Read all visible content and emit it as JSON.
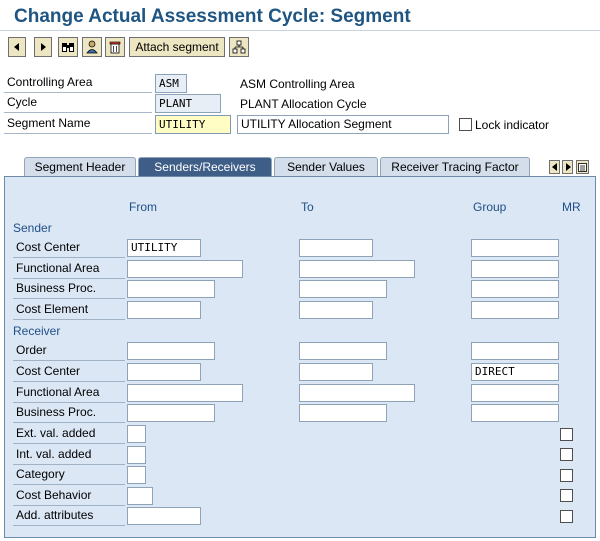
{
  "title": "Change Actual Assessment Cycle: Segment",
  "toolbar": {
    "attach_segment_label": "Attach segment"
  },
  "header": {
    "controlling_area": {
      "label": "Controlling Area",
      "value": "ASM",
      "desc": "ASM Controlling Area"
    },
    "cycle": {
      "label": "Cycle",
      "value": "PLANT",
      "desc": "PLANT Allocation Cycle"
    },
    "segment_name": {
      "label": "Segment Name",
      "value": "UTILITY",
      "desc": "UTILITY Allocation Segment"
    },
    "lock_indicator_label": "Lock indicator"
  },
  "tabs": [
    {
      "label": "Segment Header"
    },
    {
      "label": "Senders/Receivers"
    },
    {
      "label": "Sender Values"
    },
    {
      "label": "Receiver Tracing Factor"
    }
  ],
  "columns": {
    "from": "From",
    "to": "To",
    "group": "Group",
    "mr": "MR"
  },
  "sender": {
    "title": "Sender",
    "rows": [
      {
        "label": "Cost Center",
        "from": "UTILITY",
        "to": "",
        "group": ""
      },
      {
        "label": "Functional Area",
        "from": "",
        "to": "",
        "group": ""
      },
      {
        "label": "Business Proc.",
        "from": "",
        "to": "",
        "group": ""
      },
      {
        "label": "Cost Element",
        "from": "",
        "to": "",
        "group": ""
      }
    ]
  },
  "receiver": {
    "title": "Receiver",
    "rows": [
      {
        "label": "Order",
        "from": "",
        "to": "",
        "group": ""
      },
      {
        "label": "Cost Center",
        "from": "",
        "to": "",
        "group": "DIRECT"
      },
      {
        "label": "Functional Area",
        "from": "",
        "to": "",
        "group": ""
      },
      {
        "label": "Business Proc.",
        "from": "",
        "to": "",
        "group": ""
      },
      {
        "label": "Ext. val. added",
        "from": ""
      },
      {
        "label": "Int. val. added",
        "from": ""
      },
      {
        "label": "Category",
        "from": ""
      },
      {
        "label": "Cost Behavior",
        "from": ""
      },
      {
        "label": "Add. attributes",
        "from": ""
      }
    ]
  },
  "icons": {
    "back": "arrow-left-icon",
    "forward": "arrow-right-icon",
    "find": "binoculars-icon",
    "person": "person-icon",
    "delete": "trash-icon",
    "structure": "hierarchy-icon",
    "tab_prev": "tab-prev-icon",
    "tab_next": "tab-next-icon",
    "tab_list": "tab-list-icon"
  },
  "colors": {
    "title": "#1f5582",
    "panel_bg": "#dbe7f5",
    "active_tab": "#3e5e88",
    "section_text": "#1f4f86",
    "edit_field": "#fffcc4"
  }
}
